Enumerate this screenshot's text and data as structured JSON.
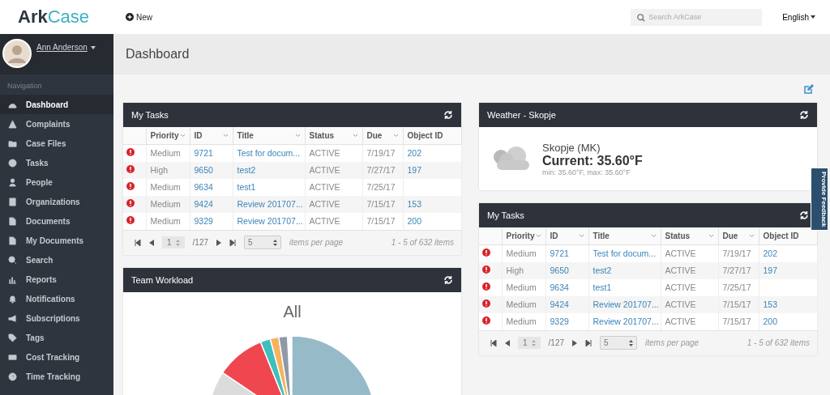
{
  "header": {
    "logo": "**Ark**Case",
    "new_button": "New",
    "search": {
      "placeholder": "Search ArkCase"
    },
    "language": "English"
  },
  "sidebar": {
    "user": {
      "name": "Ann Anderson"
    },
    "section_label": "Navigation",
    "items": [
      {
        "label": "Dashboard",
        "selected": true
      },
      {
        "label": "Complaints",
        "selected": false
      },
      {
        "label": "Case Files",
        "selected": false
      },
      {
        "label": "Tasks",
        "selected": false
      },
      {
        "label": "People",
        "selected": false
      },
      {
        "label": "Organizations",
        "selected": false
      },
      {
        "label": "Documents",
        "selected": false
      },
      {
        "label": "My Documents",
        "selected": false
      },
      {
        "label": "Search",
        "selected": false
      },
      {
        "label": "Reports",
        "selected": false
      },
      {
        "label": "Notifications",
        "selected": false
      },
      {
        "label": "Subscriptions",
        "selected": false
      },
      {
        "label": "Tags",
        "selected": false
      },
      {
        "label": "Cost Tracking",
        "selected": false
      },
      {
        "label": "Time Tracking",
        "selected": false
      }
    ]
  },
  "page_title": "Dashboard",
  "columns": [
    [
      {
        "kind": "tasks",
        "title": "My Tasks",
        "table": {
          "columns": [
            {
              "label": "Priority",
              "sortable": true,
              "kind": "text"
            },
            {
              "label": "ID",
              "sortable": true,
              "kind": "link"
            },
            {
              "label": "Title",
              "sortable": true,
              "kind": "link"
            },
            {
              "label": "Status",
              "sortable": true,
              "kind": "text"
            },
            {
              "label": "Due",
              "sortable": true,
              "kind": "text"
            },
            {
              "label": "Object ID",
              "sortable": false,
              "kind": "link"
            }
          ],
          "rows": [
            [
              "Medium",
              "9721",
              "Test for docum...",
              "ACTIVE",
              "7/19/17",
              "202"
            ],
            [
              "High",
              "9650",
              "test2",
              "ACTIVE",
              "7/27/17",
              "197"
            ],
            [
              "Medium",
              "9634",
              "test1",
              "ACTIVE",
              "7/25/17",
              null
            ],
            [
              "Medium",
              "9424",
              "Review 201707...",
              "ACTIVE",
              "7/15/17",
              "153"
            ],
            [
              "Medium",
              "9329",
              "Review 201707...",
              "ACTIVE",
              "7/15/17",
              "200"
            ]
          ]
        },
        "pager": {
          "page": "1",
          "total": "/127",
          "per_page": "5",
          "per_page_label": "items per page",
          "summary": "1 - 5 of 632 items"
        }
      },
      {
        "kind": "chart",
        "title": "Team Workload",
        "chart_title": "All"
      }
    ],
    [
      {
        "kind": "weather",
        "title": "Weather - Skopje",
        "city": "Skopje (MK)",
        "current": "Current: 35.60°F",
        "range": "min: 35.60°F, max: 35.60°F"
      },
      {
        "kind": "tasks",
        "title": "My Tasks",
        "table": {
          "columns": [
            {
              "label": "Priority",
              "sortable": true,
              "kind": "text"
            },
            {
              "label": "ID",
              "sortable": true,
              "kind": "link"
            },
            {
              "label": "Title",
              "sortable": true,
              "kind": "link"
            },
            {
              "label": "Status",
              "sortable": true,
              "kind": "text"
            },
            {
              "label": "Due",
              "sortable": true,
              "kind": "text"
            },
            {
              "label": "Object ID",
              "sortable": false,
              "kind": "link"
            }
          ],
          "rows": [
            [
              "Medium",
              "9721",
              "Test for docum...",
              "ACTIVE",
              "7/19/17",
              "202"
            ],
            [
              "High",
              "9650",
              "test2",
              "ACTIVE",
              "7/27/17",
              "197"
            ],
            [
              "Medium",
              "9634",
              "test1",
              "ACTIVE",
              "7/25/17",
              null
            ],
            [
              "Medium",
              "9424",
              "Review 201707...",
              "ACTIVE",
              "7/15/17",
              "153"
            ],
            [
              "Medium",
              "9329",
              "Review 201707...",
              "ACTIVE",
              "7/15/17",
              "200"
            ]
          ]
        },
        "pager": {
          "page": "1",
          "total": "/127",
          "per_page": "5",
          "per_page_label": "items per page",
          "summary": "1 - 5 of 632 items"
        }
      }
    ]
  ],
  "feedback_tab": "Provide Feedback"
}
